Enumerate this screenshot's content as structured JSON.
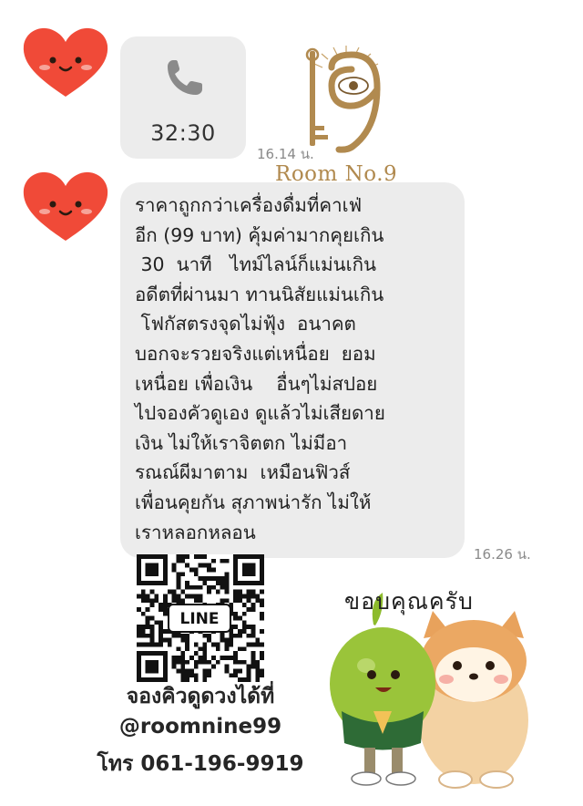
{
  "call": {
    "duration": "32:30",
    "time": "16.14 น."
  },
  "brand": {
    "name": "Room No.9",
    "logo_glyph": "9"
  },
  "message": {
    "lines": [
      "ราคาถูกกว่าเครื่องดื่มที่คาเฟ่",
      "อีก (99 บาท) คุ้มค่ามากคุยเกิน",
      " 30  นาที   ไทม์ไลน์ก็แม่นเกิน",
      "อดีตที่ผ่านมา ทานนิสัยแม่นเกิน",
      " โฟกัสตรงจุดไม่ฟุ้ง  อนาคต",
      "บอกจะรวยจริงแต่เหนื่อย  ยอม",
      "เหนื่อย เพื่อเงิน    อื่นๆไม่สปอย",
      "ไปจองคัวดูเอง ดูแล้วไม่เสียดาย",
      "เงิน ไม่ให้เราจิตตก ไม่มีอา",
      "รณณ์ผีมาตาม  เหมือนฟิวส์",
      "เพื่อนคุยกัน สุภาพน่ารัก ไม่ให้",
      "เราหลอกหลอน"
    ],
    "time": "16.26 น."
  },
  "qr": {
    "label": "LINE"
  },
  "contact": {
    "line1": "จองคิวดูดวงได้ที่",
    "line2": "@roomnine99",
    "line3": "โทร 061-196-9919"
  },
  "sticker": {
    "caption": "ขอบคุณครับ"
  },
  "icons": {
    "avatar": "heart-face-icon",
    "call": "phone-icon",
    "logo": "key-eye-logo-icon",
    "sticker": "thank-you-sticker-icon"
  },
  "colors": {
    "bubble": "#ececec",
    "heart": "#f04a38",
    "gold": "#b18a4f"
  }
}
